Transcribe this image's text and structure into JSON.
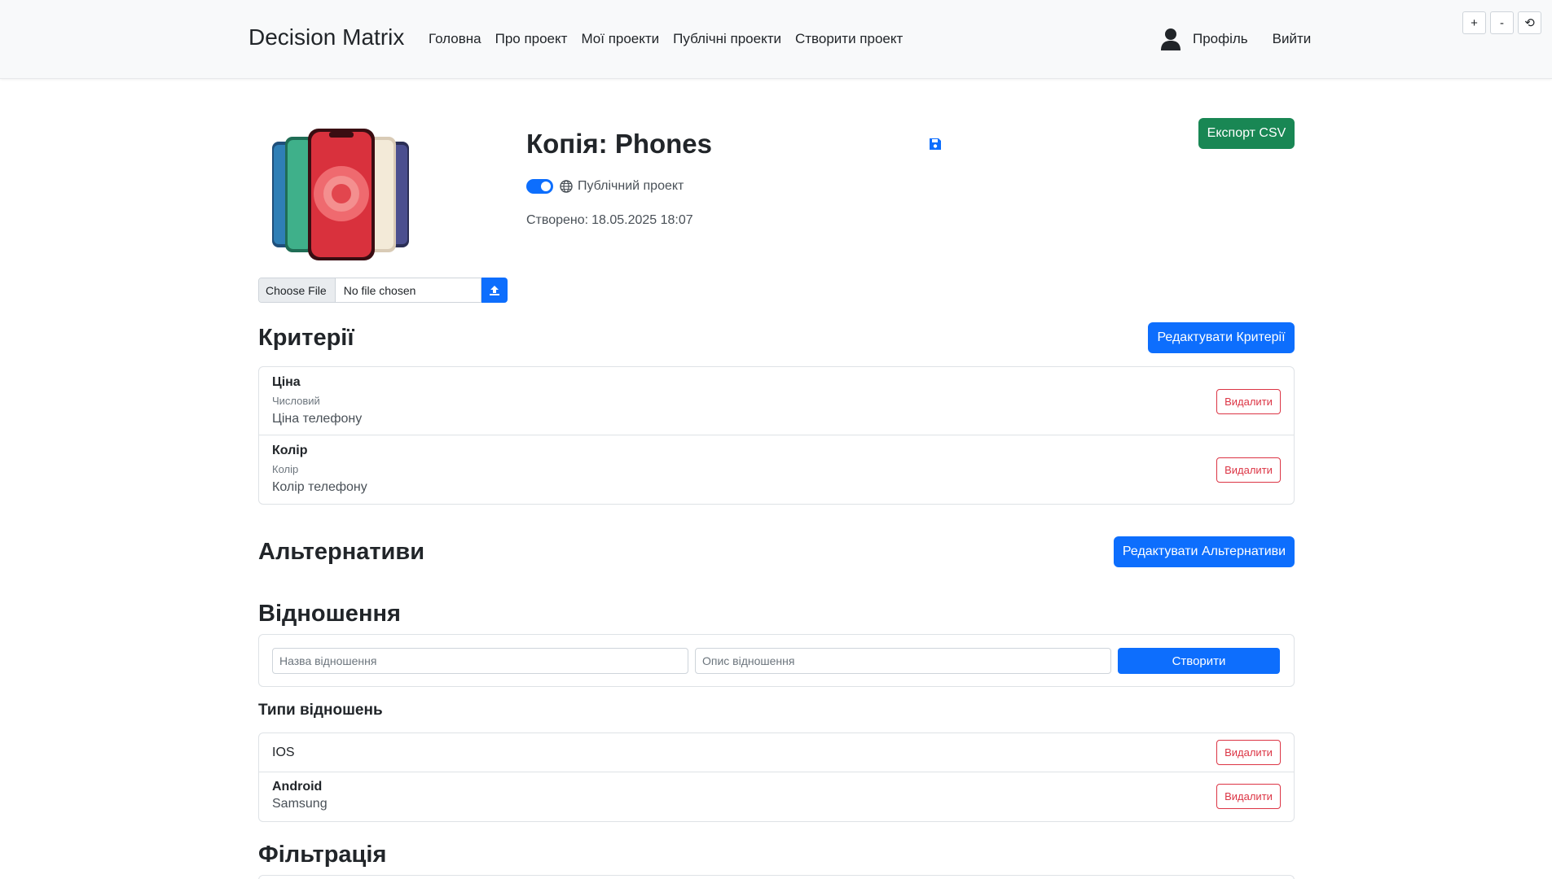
{
  "navbar": {
    "brand": "Decision Matrix",
    "links": [
      "Головна",
      "Про проект",
      "Мої проекти",
      "Публічні проекти",
      "Створити проект"
    ],
    "profile": "Профіль",
    "logout": "Вийти"
  },
  "zoom": {
    "plus": "+",
    "minus": "-",
    "reset": "⟲"
  },
  "project": {
    "title": "Копія: Phones",
    "public_label": "Публічний проект",
    "public": true,
    "created_label": "Створено:",
    "created_value": "18.05.2025 18:07",
    "export_label": "Експорт CSV",
    "file_choose": "Choose File",
    "file_status": "No file chosen"
  },
  "criteria": {
    "title": "Критерії",
    "edit_label": "Редактувати Критерії",
    "items": [
      {
        "name": "Ціна",
        "type": "Числовий",
        "description": "Ціна телефону"
      },
      {
        "name": "Колір",
        "type": "Колір",
        "description": "Колір телефону"
      }
    ],
    "delete_label": "Видалити"
  },
  "alternatives": {
    "title": "Альтернативи",
    "edit_label": "Редактувати Альтернативи"
  },
  "relations": {
    "title": "Відношення",
    "name_placeholder": "Назва відношення",
    "desc_placeholder": "Опис відношення",
    "create_label": "Створити",
    "types_title": "Типи відношень",
    "items": [
      {
        "name": "IOS",
        "description": ""
      },
      {
        "name": "Android",
        "description": "Samsung"
      }
    ],
    "delete_label": "Видалити"
  },
  "filter": {
    "title": "Фільтрація"
  },
  "colors": {
    "primary": "#0d6efd",
    "success": "#198754",
    "danger": "#dc3545"
  },
  "icons": [
    "user-icon",
    "save-icon",
    "globe-icon",
    "upload-icon",
    "phone-image"
  ]
}
